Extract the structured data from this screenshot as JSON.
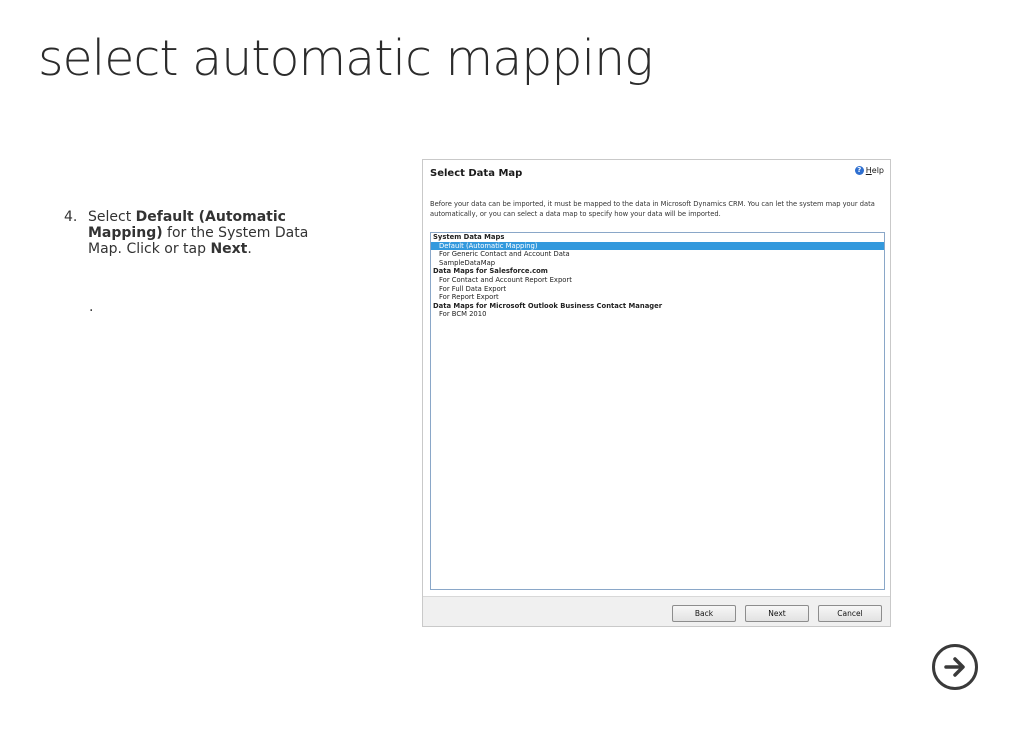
{
  "slide": {
    "title": "select automatic mapping",
    "step_number": "4.",
    "step_parts": {
      "p1": "Select ",
      "b1": "Default (Automatic Mapping)",
      "p2": " for the System Data Map. Click or tap ",
      "b2": "Next",
      "p3": "."
    },
    "note": "."
  },
  "dialog": {
    "title": "Select Data Map",
    "help_label": "Help",
    "description": "Before your data can be imported, it must be mapped to the data in Microsoft Dynamics CRM. You can let the system map your data automatically, or you can select a data map to specify how your data will be imported.",
    "groups": [
      {
        "label": "System Data Maps",
        "items": [
          "Default (Automatic Mapping)",
          "For Generic Contact and Account Data",
          "SampleDataMap"
        ]
      },
      {
        "label": "Data Maps for Salesforce.com",
        "items": [
          "For Contact and Account Report Export",
          "For Full Data Export",
          "For Report Export"
        ]
      },
      {
        "label": "Data Maps for Microsoft Outlook Business Contact Manager",
        "items": [
          "For BCM 2010"
        ]
      }
    ],
    "selected_item": "Default (Automatic Mapping)",
    "buttons": {
      "back": "Back",
      "next": "Next",
      "cancel": "Cancel"
    }
  },
  "icons": {
    "help": "help-icon",
    "next_slide": "arrow-right-circle-icon"
  },
  "colors": {
    "selection": "#3399dd",
    "help_icon": "#2e6fd0"
  }
}
